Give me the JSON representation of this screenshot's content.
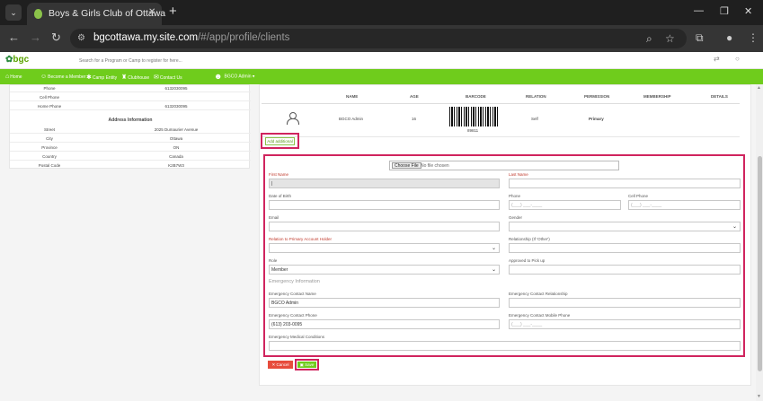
{
  "browser": {
    "tab_title": "Boys & Girls Club of Ottawa",
    "url_host": "bgcottawa.my.site.com",
    "url_path": "/#/app/profile/clients"
  },
  "app": {
    "logo_text": "bgc",
    "search_placeholder": "Search for a Program or Camp to register for here...",
    "menu": [
      "Home",
      "Become a Member",
      "Camp Entity",
      "Clubhouse",
      "Contact Us"
    ],
    "user_label": "BGCO Admin ▾",
    "accent_color": "#6fcc1c",
    "highlight_color": "#d0245e"
  },
  "profile": {
    "rows_top": [
      {
        "label": "Phone",
        "value": "6132030095"
      },
      {
        "label": "Cell Phone",
        "value": ""
      },
      {
        "label": "Home Phone",
        "value": "6132030095"
      }
    ],
    "address_title": "Address Information",
    "address_rows": [
      {
        "label": "Street",
        "value": "2025 Dumaurier Avenue"
      },
      {
        "label": "City",
        "value": "Ottawa"
      },
      {
        "label": "Province",
        "value": "ON"
      },
      {
        "label": "Country",
        "value": "Canada"
      },
      {
        "label": "Postal Code",
        "value": "K2B7W3"
      }
    ]
  },
  "members_table": {
    "headers": [
      "NAME",
      "AGE",
      "BARCODE",
      "RELATION",
      "PERMISSION",
      "MEMBERSHIP",
      "DETAILS"
    ],
    "row": {
      "name": "BGCO Admin",
      "age": "16",
      "barcode": "89811",
      "relation": "Self",
      "permission": "Primary"
    }
  },
  "add_additional_label": "Add additional",
  "form": {
    "file_button": "Choose File",
    "file_status": "No file chosen",
    "first_name_label": "First Name",
    "first_name_value": "|",
    "last_name_label": "Last Name",
    "dob_label": "Date of Birth",
    "phone_label": "Phone",
    "phone_placeholder": "(___) ___-____",
    "cell_phone_label": "Cell Phone",
    "cell_phone_placeholder": "(___) ___-____",
    "email_label": "Email",
    "gender_label": "Gender",
    "relation_label": "Relation to Primary Account Holder",
    "relationship_other_label": "Relationship (If 'Other')",
    "role_label": "Role",
    "role_value": "Member",
    "pickup_label": "Approved to Pick up",
    "emergency_title": "Emergency Information",
    "ec_name_label": "Emergency Contact Name",
    "ec_name_value": "BGCO Admin",
    "ec_relationship_label": "Emergency Contact Relationship",
    "ec_phone_label": "Emergency Contact Phone",
    "ec_phone_value": "(613) 203-0095",
    "ec_mobile_label": "Emergency Contact Mobile Phone",
    "ec_mobile_placeholder": "(___) ___-____",
    "medical_label": "Emergency Medical Conditions"
  },
  "actions": {
    "cancel_label": "✕ Cancel",
    "save_label": "▣ Save"
  }
}
